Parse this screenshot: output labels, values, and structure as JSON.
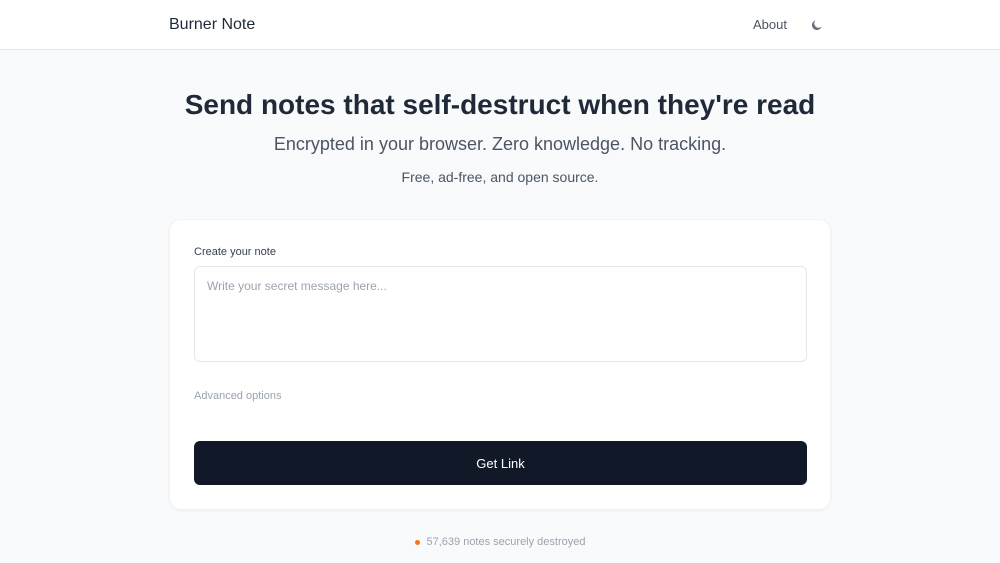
{
  "header": {
    "brand": "Burner Note",
    "about_label": "About",
    "theme_icon": "moon-icon"
  },
  "hero": {
    "title": "Send notes that self-destruct when they're read",
    "subtitle": "Encrypted in your browser. Zero knowledge. No tracking.",
    "tagline": "Free, ad-free, and open source."
  },
  "form": {
    "label": "Create your note",
    "note_value": "",
    "note_placeholder": "Write your secret message here...",
    "advanced_label": "Advanced options",
    "submit_label": "Get Link"
  },
  "footer": {
    "stat_text": "57,639 notes securely destroyed",
    "dot_color": "#f97316"
  },
  "colors": {
    "background": "#f8fafc",
    "button": "#111827",
    "accent": "#f97316"
  }
}
